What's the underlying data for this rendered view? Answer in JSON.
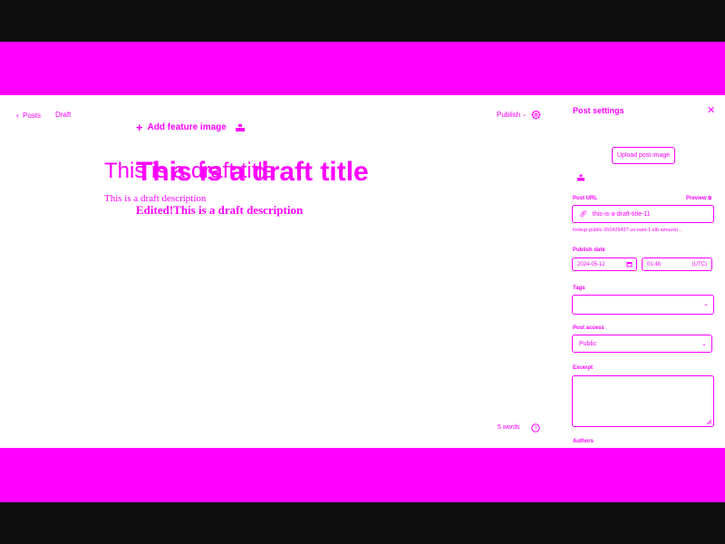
{
  "colors": {
    "accent": "#ff00ff",
    "frame": "#0e0e0e",
    "surface": "#ffffff"
  },
  "editor": {
    "back_label": "Posts",
    "status_label": "Draft",
    "publish_label": "Publish",
    "add_feature_image": "Add feature image",
    "title_ghost": "This is a draft title",
    "title": "This is a draft title",
    "description_ghost": "This is a draft description",
    "description": "Edited!This is a draft description",
    "word_count": "5 words"
  },
  "sidebar": {
    "title": "Post settings",
    "upload_label": "Upload post image",
    "post_url_label": "Post URL",
    "preview_label": "Preview",
    "post_url_value": "this-is-a-draft-title-11",
    "post_url_hint": "lookup-public-260429427.us-east-1.elb.amazon...",
    "publish_date_label": "Publish date",
    "publish_date": "2024-05-12",
    "publish_time": "01:48",
    "timezone": "(UTC)",
    "tags_label": "Tags",
    "access_label": "Post access",
    "access_value": "Public",
    "excerpt_label": "Excerpt",
    "excerpt_value": "",
    "authors_label": "Authors"
  },
  "icons": [
    "chevron-left-icon",
    "chevron-down-icon",
    "settings-icon",
    "plus-icon",
    "image-icon",
    "link-icon",
    "calendar-icon",
    "close-icon",
    "help-icon",
    "external-link-icon",
    "resize-icon"
  ]
}
